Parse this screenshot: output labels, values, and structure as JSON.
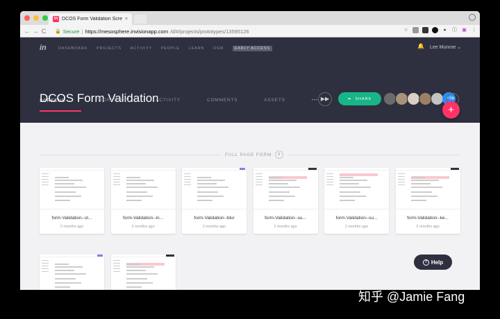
{
  "browser": {
    "tab_title": "DCOS Form Validation Screens",
    "tab_close": "×",
    "secure_label": "Secure",
    "url_host": "https://mesosphere.invisionapp.com",
    "url_path": "/d/#/projects/prototypes/13595126",
    "nav_back": "←",
    "nav_forward": "→",
    "nav_reload": "C"
  },
  "app": {
    "logo": "in",
    "nav": [
      "DASHBOARD",
      "PROJECTS",
      "ACTIVITY",
      "PEOPLE",
      "LEARN",
      "DSM"
    ],
    "early_access": "EARLY ACCESS",
    "user_name": "Lee Munroe ⌄",
    "project_title": "DCOS Form Validation",
    "share_label": "SHARE",
    "avatars_more": "+2",
    "add_person": "+",
    "tabs": [
      "SCREENS ⌄",
      "WORKFLOW",
      "ACTIVITY",
      "COMMENTS",
      "ASSETS",
      "•••"
    ],
    "fab": "+"
  },
  "section": {
    "label": "FULL PAGE FORM",
    "count": "8"
  },
  "screens": [
    {
      "name": "form-Validation--st...",
      "time": "2 months ago"
    },
    {
      "name": "form-Validation--in...",
      "time": "2 months ago"
    },
    {
      "name": "form-Validation--blur",
      "time": "2 months ago"
    },
    {
      "name": "form-Validation--su...",
      "time": "2 months ago"
    },
    {
      "name": "form-Validation--su...",
      "time": "2 months ago"
    },
    {
      "name": "form-Validation--ke...",
      "time": "2 months ago"
    },
    {
      "name": "",
      "time": ""
    },
    {
      "name": "",
      "time": ""
    }
  ],
  "help_label": "Help",
  "watermark": "知乎 @Jamie Fang",
  "colors": {
    "accent": "#ff3366",
    "share": "#17b587",
    "header": "#2e3040"
  }
}
